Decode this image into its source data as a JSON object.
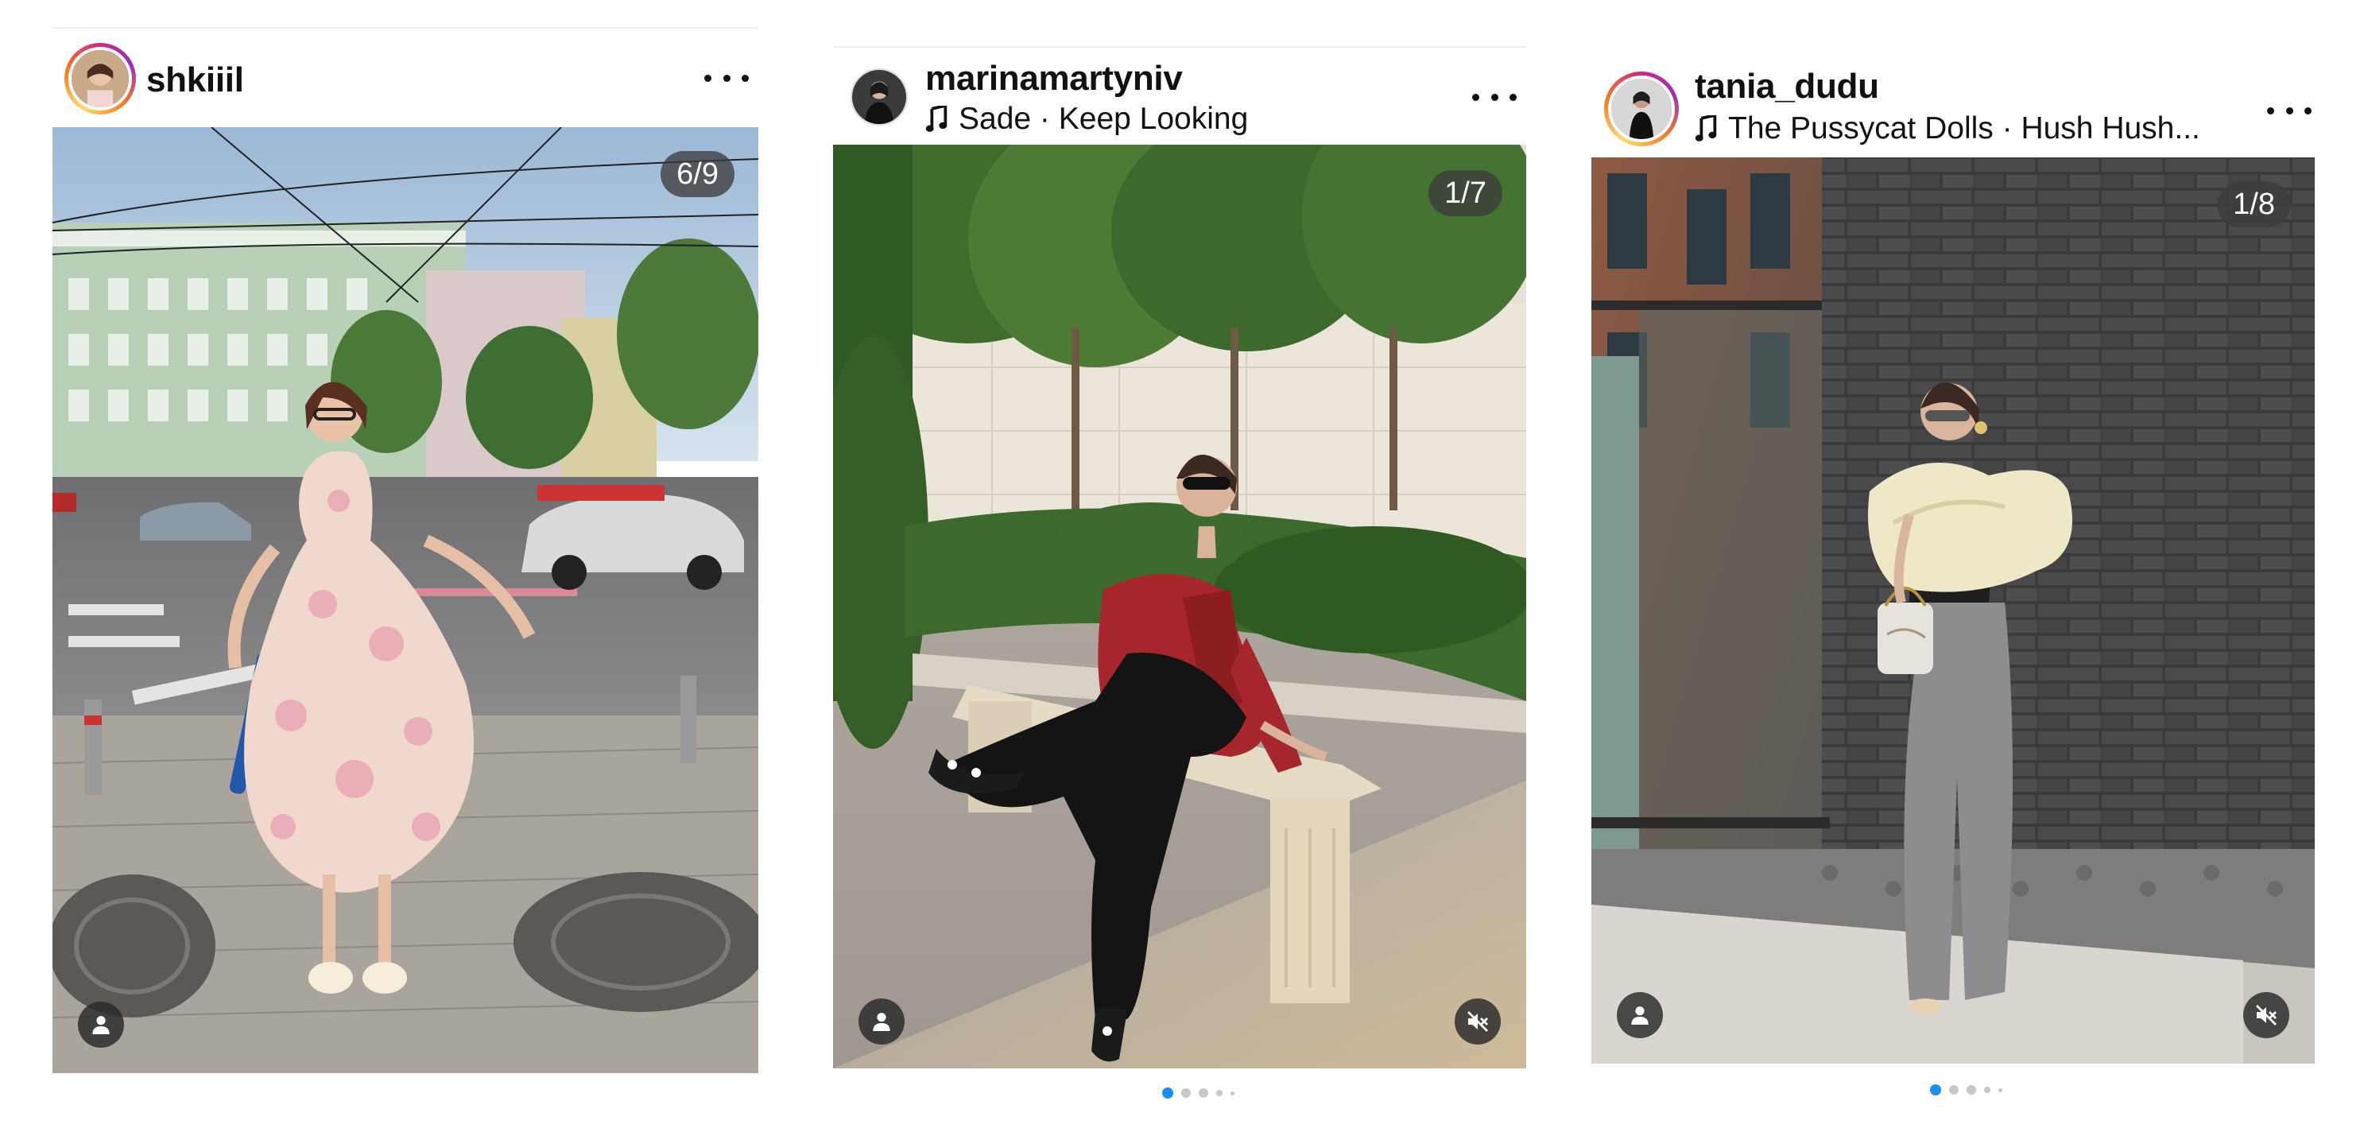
{
  "posts": [
    {
      "username": "shkiiil",
      "music": "",
      "counter": "6/9",
      "icons": {
        "more": "more-dots-icon",
        "tag": "person-tag-icon"
      }
    },
    {
      "username": "marinamartyniv",
      "music": "Sade · Keep Looking",
      "counter": "1/7",
      "icons": {
        "more": "more-dots-icon",
        "tag": "person-tag-icon",
        "sound": "sound-muted-icon",
        "music": "music-note-icon"
      },
      "carousel": {
        "total": 5,
        "active": 1
      }
    },
    {
      "username": "tania_dudu",
      "music": "The Pussycat Dolls · Hush Hush...",
      "counter": "1/8",
      "icons": {
        "more": "more-dots-icon",
        "tag": "person-tag-icon",
        "sound": "sound-muted-icon",
        "music": "music-note-icon"
      },
      "carousel": {
        "total": 5,
        "active": 1
      }
    }
  ],
  "colors": {
    "story_ring": [
      "#feda75",
      "#fa7e1e",
      "#d62976",
      "#962fbf"
    ],
    "carousel_active": "#1a8ff2",
    "carousel_inactive": "#c8c8c8"
  }
}
